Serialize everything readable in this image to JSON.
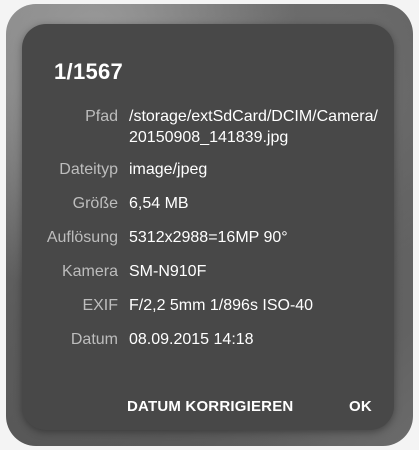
{
  "dialog": {
    "title": "1/1567",
    "rows": [
      {
        "label": "Pfad",
        "value": "/storage/extSdCard/DCIM/Camera/20150908_141839.jpg"
      },
      {
        "label": "Dateityp",
        "value": "image/jpeg"
      },
      {
        "label": "Größe",
        "value": "6,54 MB"
      },
      {
        "label": "Auflösung",
        "value": "5312x2988=16MP 90°"
      },
      {
        "label": "Kamera",
        "value": "SM-N910F"
      },
      {
        "label": "EXIF",
        "value": "F/2,2 5mm 1/896s ISO-40"
      },
      {
        "label": "Datum",
        "value": "08.09.2015 14:18"
      }
    ],
    "actions": {
      "fix_date_label": "DATUM KORRIGIEREN",
      "ok_label": "OK"
    }
  },
  "colors": {
    "dialog_background": "#484848",
    "label_text": "#bdbdbd",
    "value_text": "#ffffff"
  }
}
